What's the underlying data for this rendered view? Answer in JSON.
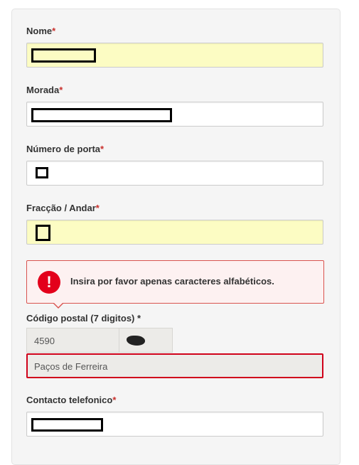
{
  "form": {
    "nome": {
      "label": "Nome",
      "required": "*",
      "value": ""
    },
    "morada": {
      "label": "Morada",
      "required": "*",
      "value": ""
    },
    "porta": {
      "label": "Número de porta",
      "required": "*",
      "value": ""
    },
    "fraccao": {
      "label": "Fracção / Andar",
      "required": "*",
      "value": ""
    },
    "error": {
      "icon": "!",
      "message": "Insira por favor apenas caracteres alfabéticos."
    },
    "postal": {
      "label": "Código postal (7 digitos)",
      "required": " *",
      "prefix": "4590",
      "suffix": "",
      "city": "Paços de Ferreira"
    },
    "telefone": {
      "label": "Contacto telefonico",
      "required": "*",
      "value": ""
    }
  },
  "colors": {
    "required_star": "#c9302c",
    "highlight_field": "#fcfcc3",
    "error_border": "#d0021b",
    "error_icon": "#e3001b",
    "disabled_field": "#ecebe8"
  }
}
